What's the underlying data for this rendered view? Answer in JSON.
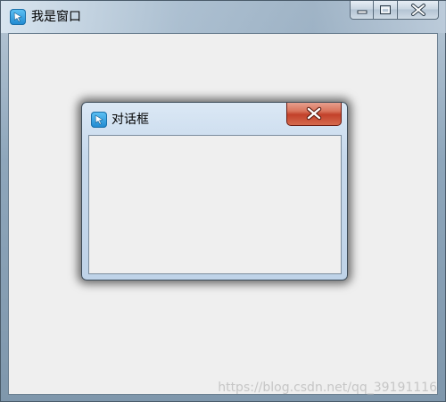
{
  "main_window": {
    "title": "我是窗口",
    "icon": "app-cursor-icon"
  },
  "dialog": {
    "title": "对话框",
    "icon": "app-cursor-icon"
  },
  "caption_buttons": [
    "minimize-icon",
    "maximize-icon",
    "close-icon"
  ],
  "watermark": "https://blog.csdn.net/qq_39191116",
  "colors": {
    "close_button": "#c2412a",
    "app_icon": "#1e88d0"
  }
}
